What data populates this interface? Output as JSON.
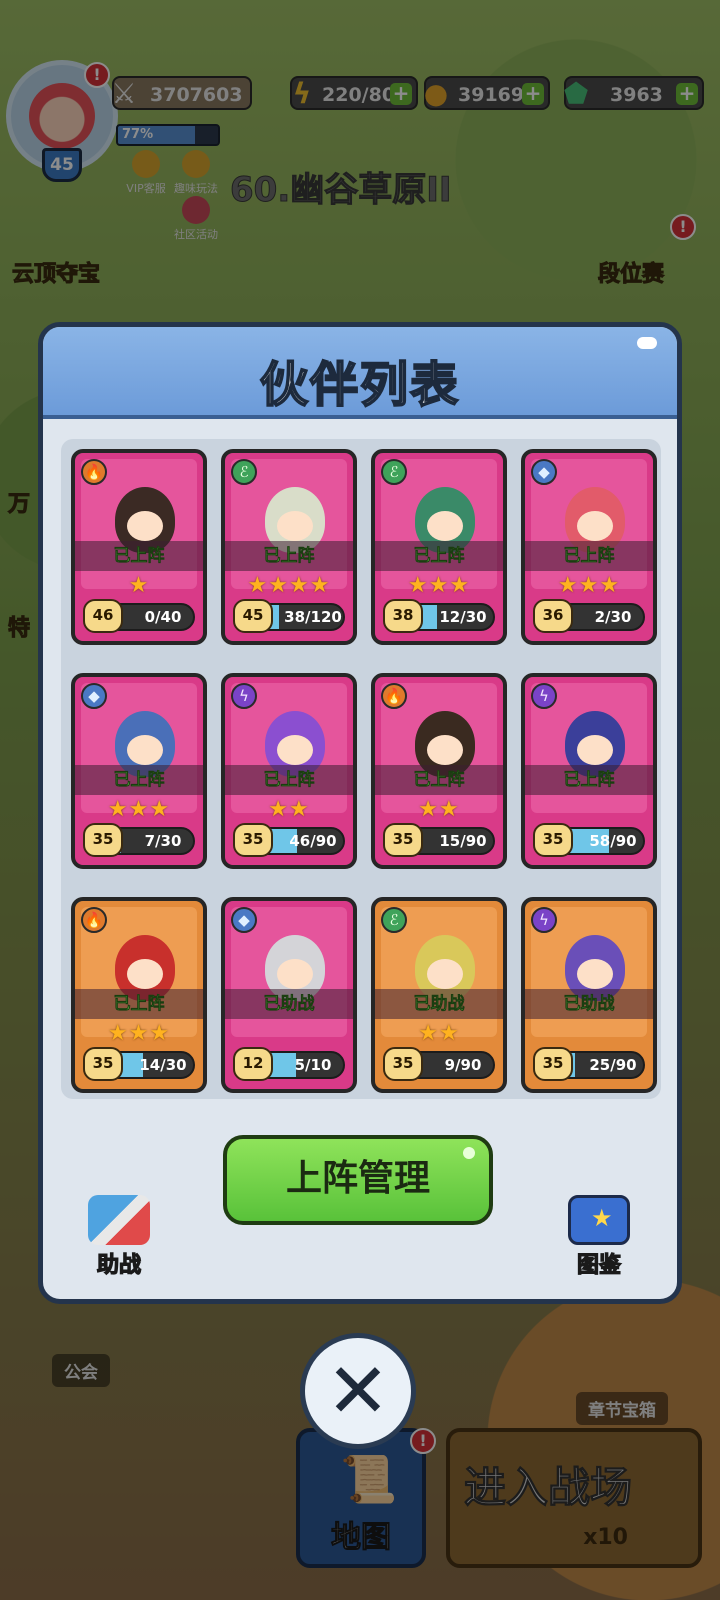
{
  "hud": {
    "power": "3707603",
    "energy": "220/80",
    "gold": "39169",
    "gems": "3963",
    "player_level": "45",
    "xp_percent": "77%",
    "xp_fraction": 0.77,
    "vip_label": "VIP客服",
    "fun_label": "趣味玩法",
    "community_label": "社区活动",
    "stage_title": "60.幽谷草原II",
    "left_event": "云顶夺宝",
    "rank_label": "段位赛",
    "side_text_1": "万",
    "side_text_2": "特"
  },
  "bottom": {
    "guild_label": "公会",
    "chest_label": "章节宝箱",
    "map_label": "地图",
    "enter_label": "进入战场",
    "enter_cost": "x10"
  },
  "modal": {
    "title": "伙伴列表",
    "manage_button": "上阵管理",
    "assist_button": "助战",
    "codex_button": "图鉴",
    "close_icon": "close-icon"
  },
  "partners": [
    {
      "element": "fire",
      "status": "已上阵",
      "stars": 1,
      "level": "46",
      "progress": "0/40",
      "fraction": 0.0,
      "frame": "pink",
      "hair": "#3b2a24"
    },
    {
      "element": "wind",
      "status": "已上阵",
      "stars": 4,
      "level": "45",
      "progress": "38/120",
      "fraction": 0.32,
      "frame": "pink",
      "hair": "#d9ddc9"
    },
    {
      "element": "wind",
      "status": "已上阵",
      "stars": 3,
      "level": "38",
      "progress": "12/30",
      "fraction": 0.4,
      "frame": "pink",
      "hair": "#3a8a68"
    },
    {
      "element": "ice",
      "status": "已上阵",
      "stars": 3,
      "level": "36",
      "progress": "2/30",
      "fraction": 0.07,
      "frame": "pink",
      "hair": "#e25b6a"
    },
    {
      "element": "ice",
      "status": "已上阵",
      "stars": 3,
      "level": "35",
      "progress": "7/30",
      "fraction": 0.23,
      "frame": "pink",
      "hair": "#4a6fb8"
    },
    {
      "element": "thunder",
      "status": "已上阵",
      "stars": 2,
      "level": "35",
      "progress": "46/90",
      "fraction": 0.51,
      "frame": "pink",
      "hair": "#8b4fd0"
    },
    {
      "element": "fire",
      "status": "已上阵",
      "stars": 2,
      "level": "35",
      "progress": "15/90",
      "fraction": 0.17,
      "frame": "pink",
      "hair": "#3a2a20"
    },
    {
      "element": "thunder",
      "status": "已上阵",
      "stars": 0,
      "level": "35",
      "progress": "58/90",
      "fraction": 0.64,
      "frame": "pink",
      "hair": "#3b3f9a"
    },
    {
      "element": "fire",
      "status": "已上阵",
      "stars": 3,
      "level": "35",
      "progress": "14/30",
      "fraction": 0.47,
      "frame": "orange",
      "hair": "#c8302c"
    },
    {
      "element": "ice",
      "status": "已助战",
      "stars": 0,
      "level": "12",
      "progress": "5/10",
      "fraction": 0.5,
      "frame": "pink",
      "hair": "#d4d4d8"
    },
    {
      "element": "wind",
      "status": "已助战",
      "stars": 2,
      "level": "35",
      "progress": "9/90",
      "fraction": 0.1,
      "frame": "orange",
      "hair": "#d9c85a"
    },
    {
      "element": "thunder",
      "status": "已助战",
      "stars": 0,
      "level": "35",
      "progress": "25/90",
      "fraction": 0.28,
      "frame": "orange",
      "hair": "#6a4fb8"
    }
  ],
  "element_icons": {
    "fire": "🔥",
    "wind": "ℰ",
    "ice": "◆",
    "thunder": "ϟ"
  }
}
